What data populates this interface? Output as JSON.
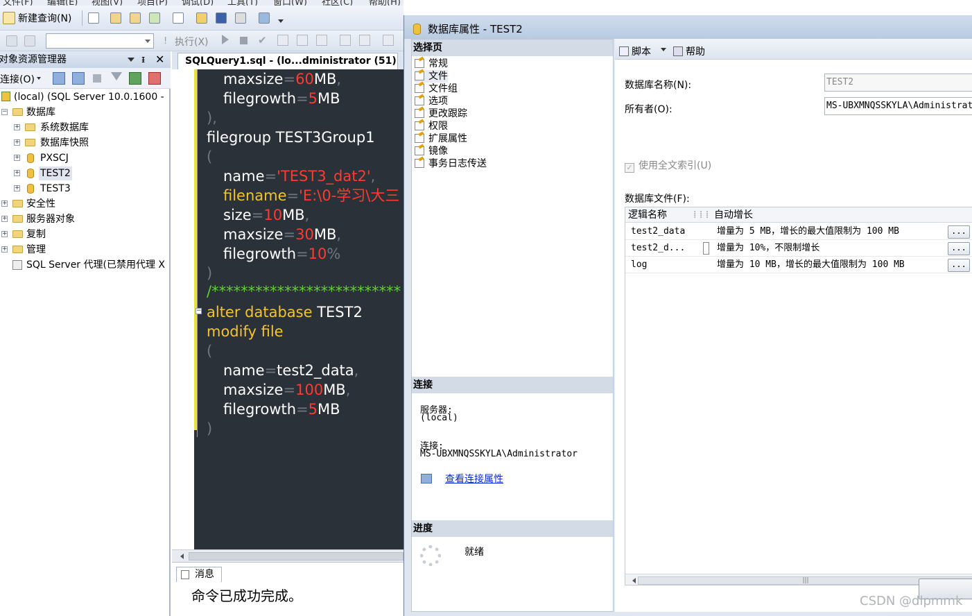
{
  "menubar": {
    "items": [
      "文件(F)",
      "编辑(E)",
      "视图(V)",
      "项目(P)",
      "调试(D)",
      "工具(T)",
      "窗口(W)",
      "社区(C)",
      "帮助(H)"
    ]
  },
  "toolbar": {
    "new_query_label": "新建查询(N)",
    "execute_label": "执行(X)"
  },
  "object_explorer": {
    "title": "对象资源管理器",
    "connect_label": "连接(O)",
    "server_node": "(local) (SQL Server 10.0.1600 -",
    "databases_label": "数据库",
    "db_children": [
      "系统数据库",
      "数据库快照",
      "PXSCJ",
      "TEST2",
      "TEST3"
    ],
    "top_folders": [
      "安全性",
      "服务器对象",
      "复制",
      "管理"
    ],
    "agent_label": "SQL Server 代理(已禁用代理 X"
  },
  "editor": {
    "tab_title": "SQLQuery1.sql - (lo...dministrator (51))*",
    "lines": {
      "l1_kw": "maxsize",
      "l1_eq": "=",
      "l1_num": "60",
      "l1_unit": "MB",
      "l1_p": ",",
      "l2_kw": "filegrowth",
      "l2_eq": "=",
      "l2_num": "5",
      "l2_unit": "MB",
      "l3": "),",
      "l4": "filegroup TEST3Group1",
      "l5": "(",
      "l6_kw": "name",
      "l6_eq": "=",
      "l6_str": "'TEST3_dat2'",
      "l6_p": ",",
      "l7_kw": "filename",
      "l7_eq": "=",
      "l7_str": "'E:\\0-学习\\大三",
      "l8_kw": "size",
      "l8_eq": "=",
      "l8_num": "10",
      "l8_unit": "MB",
      "l8_p": ",",
      "l9_kw": "maxsize",
      "l9_eq": "=",
      "l9_num": "30",
      "l9_unit": "MB",
      "l9_p": ",",
      "l10_kw": "filegrowth",
      "l10_eq": "=",
      "l10_num": "10",
      "l10_unit": "%",
      "l11": ")",
      "l12": "/**************************",
      "l13_kw": "alter database",
      "l13_rest": " TEST2",
      "l14": "modify file",
      "l15": "(",
      "l16_kw": "name",
      "l16_eq": "=",
      "l16_val": "test2_data",
      "l16_p": ",",
      "l17_kw": "maxsize",
      "l17_eq": "=",
      "l17_num": "100",
      "l17_unit": "MB",
      "l17_p": ",",
      "l18_kw": "filegrowth",
      "l18_eq": "=",
      "l18_num": "5",
      "l18_unit": "MB",
      "l19": ")"
    }
  },
  "messages": {
    "tab_label": "消息",
    "text": "命令已成功完成。"
  },
  "dialog": {
    "title": "数据库属性 - TEST2",
    "select_page_header": "选择页",
    "pages": [
      "常规",
      "文件",
      "文件组",
      "选项",
      "更改跟踪",
      "权限",
      "扩展属性",
      "镜像",
      "事务日志传送"
    ],
    "connection_header": "连接",
    "server_label": "服务器:",
    "server_value": "(local)",
    "connection_label": "连接:",
    "connection_value": "MS-UBXMNQSSKYLA\\Administrator",
    "view_conn_link": "查看连接属性",
    "progress_header": "进度",
    "status": "就绪",
    "script_label": "脚本",
    "help_label": "帮助",
    "db_name_label": "数据库名称(N):",
    "db_name_value": "TEST2",
    "owner_label": "所有者(O):",
    "owner_value": "MS-UBXMNQSSKYLA\\Administrat",
    "fulltext_label": "使用全文索引(U)",
    "db_files_label": "数据库文件(F):",
    "grid_headers": {
      "logical_name": "逻辑名称",
      "autogrowth": "自动增长"
    },
    "grid_rows": [
      {
        "name": "test2_data",
        "growth": "增量为 5 MB，增长的最大值限制为 100 MB"
      },
      {
        "name": "test2_d...",
        "growth": "增量为 10%，不限制增长"
      },
      {
        "name": "log",
        "growth": "增量为 10 MB，增长的最大值限制为 100 MB"
      }
    ],
    "ellipsis": "..."
  },
  "watermark": "CSDN @dlpmmk"
}
